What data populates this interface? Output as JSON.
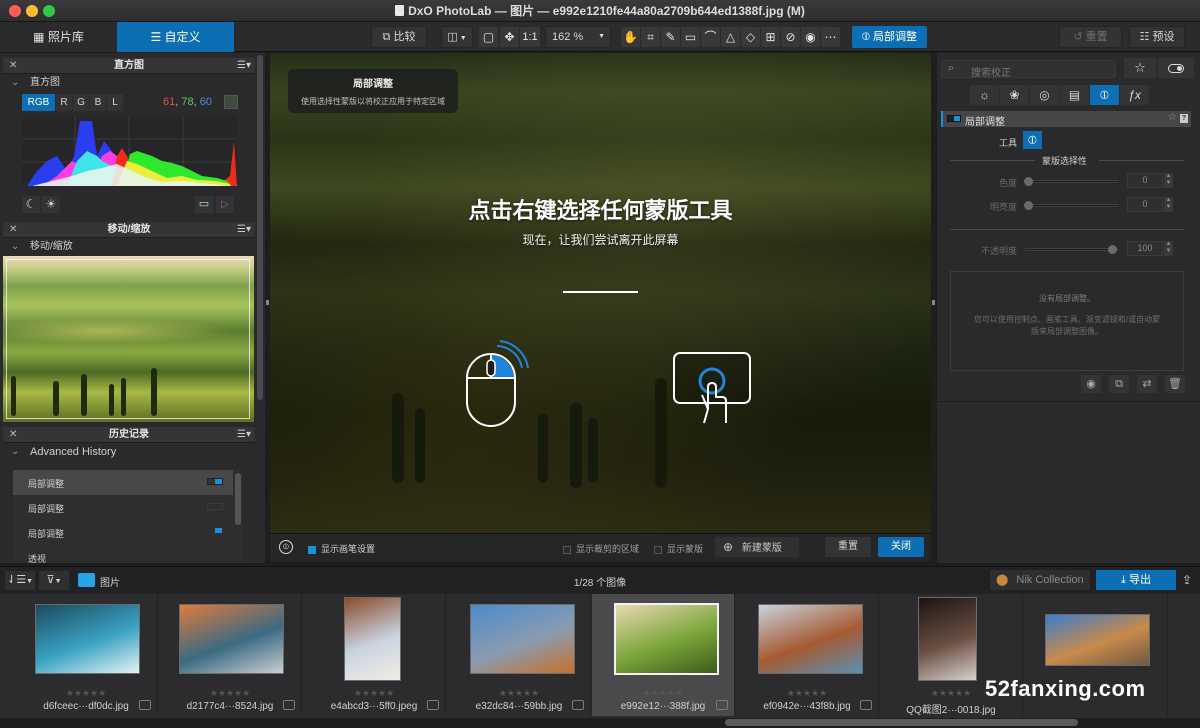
{
  "window": {
    "title": "DxO PhotoLab — 图片 — e992e1210fe44a80a2709b644ed1388f.jpg (M)",
    "traffic_lights": [
      "#fc5e57",
      "#fdbc2e",
      "#33c748"
    ]
  },
  "toolbar": {
    "tabs": [
      {
        "label": "照片库",
        "icon": "grid-icon",
        "active": false
      },
      {
        "label": "自定义",
        "icon": "sliders-icon",
        "active": true
      }
    ],
    "compare_label": "比较",
    "one_to_one_label": "1:1",
    "zoom_value": "162 %",
    "tools": [
      "hand-icon",
      "crop-icon",
      "eyedropper-icon",
      "horizon-icon",
      "perspective-icon",
      "volume-deformation-icon",
      "distortion-icon",
      "grid-icon",
      "repair-icon",
      "redeye-icon",
      "mask-icon"
    ],
    "local_adjust_label": "局部调整",
    "reset_label": "重置",
    "presets_label": "预设",
    "accent": "#0d6fb3"
  },
  "left_panel": {
    "histogram": {
      "header": "直方图",
      "section": "直方图",
      "channels": [
        "RGB",
        "R",
        "G",
        "B",
        "L"
      ],
      "active_channel": "RGB",
      "rgb_readout": {
        "r": "61",
        "g": "78",
        "b": "60"
      },
      "swatch_color": "#3d4e3c"
    },
    "move_zoom": {
      "header": "移动/缩放",
      "section": "移动/缩放"
    },
    "history": {
      "header": "历史记录",
      "section": "Advanced History",
      "items": [
        {
          "label": "局部调整",
          "selected": true
        },
        {
          "label": "局部调整",
          "selected": false
        },
        {
          "label": "局部调整",
          "selected": false
        },
        {
          "label": "透视",
          "selected": false
        }
      ]
    }
  },
  "center": {
    "tooltip_title": "局部调整",
    "tooltip_text": "使用选择性蒙版以将校正应用于特定区域",
    "headline": "点击右键选择任何蒙版工具",
    "subline": "现在，让我们尝试离开此屏幕"
  },
  "bottom_bar": {
    "show_brush_settings": "显示画笔设置",
    "show_brush_checked": true,
    "show_crop_area": "显示裁剪的区域",
    "show_mask": "显示蒙版",
    "new_mask": "新建蒙版",
    "reset": "重置",
    "close": "关闭"
  },
  "right_panel": {
    "search_placeholder": "搜索校正",
    "palette_tabs": [
      "light-icon",
      "color-icon",
      "detail-icon",
      "geometry-icon",
      "local-adjust-icon",
      "fx-icon"
    ],
    "active_palette": 4,
    "section_title": "局部调整",
    "tool_label": "工具",
    "mask_selectivity": "蒙版选择性",
    "sliders": [
      {
        "label": "色度",
        "value": "0",
        "fraction": 0
      },
      {
        "label": "明亮度",
        "value": "0",
        "fraction": 0
      }
    ],
    "opacity": {
      "label": "不透明度",
      "value": "100",
      "fraction": 1
    },
    "empty_title": "没有局部调整。",
    "empty_text": "您可以使用控制点、画笔工具、渐变滤镜和/或自动蒙版来局部调整图像。"
  },
  "filmstrip": {
    "folder": "图片",
    "count": "1/28 个图像",
    "nik_label": "Nik Collection",
    "export_label": "导出",
    "items": [
      {
        "name": "d6fceec···df0dc.jpg",
        "colors": [
          "#1c4a5e",
          "#3aa3c2",
          "#e6f3f5"
        ],
        "selected": false
      },
      {
        "name": "d2177c4···8524.jpg",
        "colors": [
          "#e07a3c",
          "#3b6a82",
          "#c9ced3"
        ],
        "selected": false
      },
      {
        "name": "e4abcd3···5ff0.jpeg",
        "colors": [
          "#8a4a2c",
          "#c9d4e0",
          "#f2ece6"
        ],
        "selected": false
      },
      {
        "name": "e32dc84···59bb.jpg",
        "colors": [
          "#4b8ccc",
          "#8a9bb0",
          "#c7702c"
        ],
        "selected": false
      },
      {
        "name": "e992e12···388f.jpg",
        "colors": [
          "#e9d8b3",
          "#7aa53a",
          "#3f5a1a"
        ],
        "selected": true
      },
      {
        "name": "ef0942e···43f8b.jpg",
        "colors": [
          "#c8d3de",
          "#a65a32",
          "#5b8fb2"
        ],
        "selected": false
      },
      {
        "name": "QQ截图2···0018.jpg",
        "colors": [
          "#1a1412",
          "#6a4f43",
          "#d8d2cf"
        ],
        "selected": false
      },
      {
        "name": "",
        "colors": [
          "#3d7dc9",
          "#c98a4a",
          "#6c5a44"
        ],
        "selected": false
      }
    ],
    "rating": "★★★★★"
  },
  "watermark": "52fanxing.com"
}
